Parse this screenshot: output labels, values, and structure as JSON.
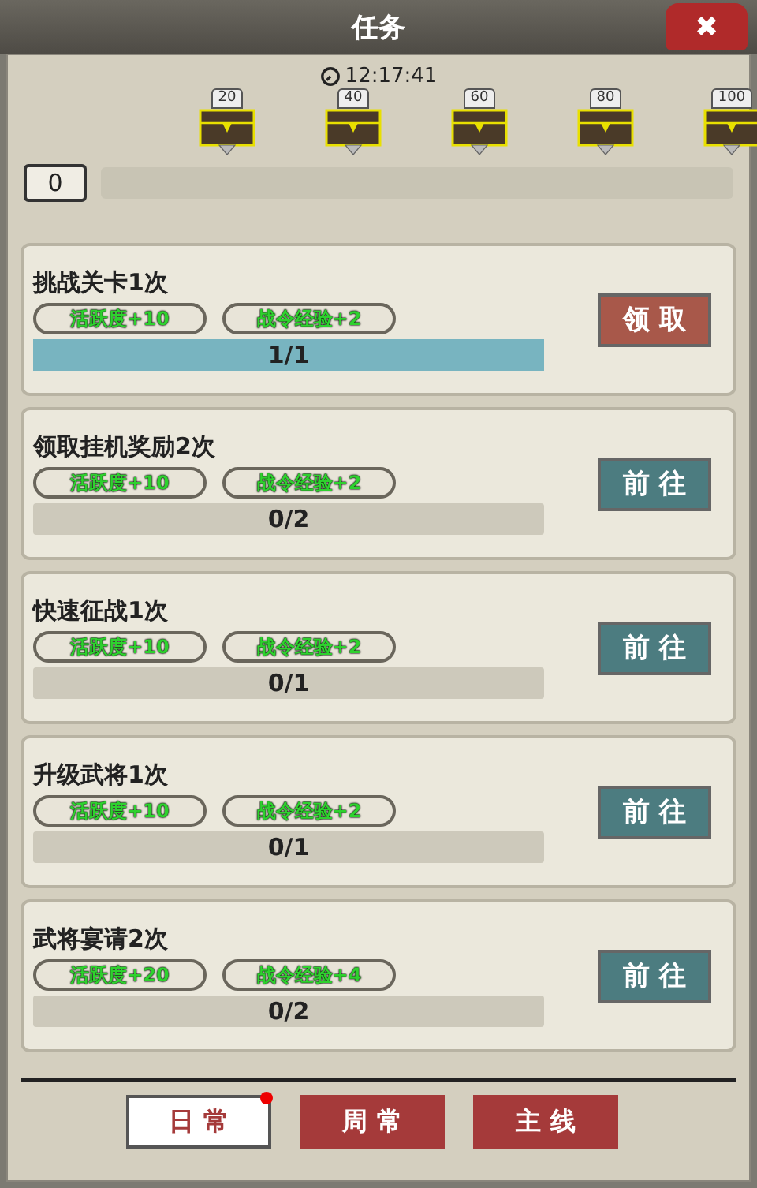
{
  "window": {
    "title": "任务",
    "close": "✖"
  },
  "timer": "12:17:41",
  "points": {
    "value": "0",
    "level": 0
  },
  "chests": [
    {
      "label": "20"
    },
    {
      "label": "40"
    },
    {
      "label": "60"
    },
    {
      "label": "80"
    },
    {
      "label": "100"
    }
  ],
  "tasks": [
    {
      "title": "挑战关卡1次",
      "rewards": [
        "活跃度+10",
        "战令经验+2"
      ],
      "progress": "1/1",
      "level": 1,
      "kind": "claim",
      "button": "领 取"
    },
    {
      "title": "领取挂机奖励2次",
      "rewards": [
        "活跃度+10",
        "战令经验+2"
      ],
      "progress": "0/2",
      "level": 0,
      "kind": "go",
      "button": "前 往"
    },
    {
      "title": "快速征战1次",
      "rewards": [
        "活跃度+10",
        "战令经验+2"
      ],
      "progress": "0/1",
      "level": 0,
      "kind": "go",
      "button": "前 往"
    },
    {
      "title": "升级武将1次",
      "rewards": [
        "活跃度+10",
        "战令经验+2"
      ],
      "progress": "0/1",
      "level": 0,
      "kind": "go",
      "button": "前 往"
    },
    {
      "title": "武将宴请2次",
      "rewards": [
        "活跃度+20",
        "战令经验+4"
      ],
      "progress": "0/2",
      "level": 0,
      "kind": "go",
      "button": "前 往"
    }
  ],
  "tabs": [
    {
      "label": "日 常",
      "selected": true,
      "badge": true
    },
    {
      "label": "周 常",
      "selected": false,
      "badge": false
    },
    {
      "label": "主 线",
      "selected": false,
      "badge": false
    }
  ]
}
